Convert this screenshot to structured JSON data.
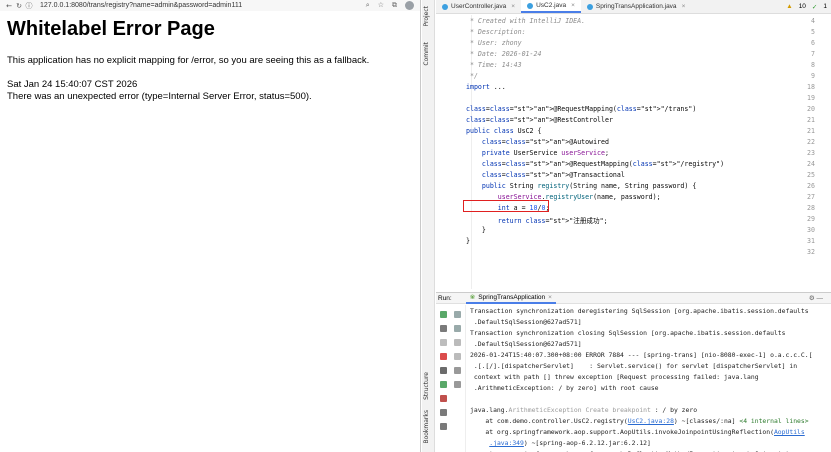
{
  "browser": {
    "url": "127.0.0.1:8080/trans/registry?name=admin&password=admin111",
    "heading": "Whitelabel Error Page",
    "message": "This application has no explicit mapping for /error, so you are seeing this as a fallback.",
    "timestamp": "Sat Jan 24 15:40:07 CST 2026",
    "error_line": "There was an unexpected error (type=Internal Server Error, status=500)."
  },
  "ide": {
    "side_labels": {
      "project": "Project",
      "commit": "Commit",
      "structure": "Structure",
      "bookmarks": "Bookmarks"
    },
    "tabs": [
      "UserController.java",
      "UsC2.java",
      "SpringTransApplication.java"
    ],
    "warn_count": "10",
    "check_count": "1",
    "code_lines": [
      {
        "n": "4",
        "t": " * Created with IntelliJ IDEA."
      },
      {
        "n": "5",
        "t": " * Description:"
      },
      {
        "n": "6",
        "t": " * User: zhony"
      },
      {
        "n": "7",
        "t": " * Date: 2026-01-24"
      },
      {
        "n": "8",
        "t": " * Time: 14:43"
      },
      {
        "n": "9",
        "t": " */"
      },
      {
        "n": "18",
        "t": "import ..."
      },
      {
        "n": "19",
        "t": ""
      },
      {
        "n": "20",
        "t": "@RequestMapping(\"/trans\")"
      },
      {
        "n": "21",
        "t": "@RestController"
      },
      {
        "n": "21",
        "t": "public class UsC2 {"
      },
      {
        "n": "22",
        "t": "    @Autowired"
      },
      {
        "n": "23",
        "t": "    private UserService userService;"
      },
      {
        "n": "24",
        "t": "    @RequestMapping(\"/registry\")"
      },
      {
        "n": "25",
        "t": "    @Transactional"
      },
      {
        "n": "26",
        "t": "    public String registry(String name, String password) {"
      },
      {
        "n": "27",
        "t": "        userService.registryUser(name, password);"
      },
      {
        "n": "28",
        "t": "        int a = 10/0;"
      },
      {
        "n": "29",
        "t": "        return \"注册成功\";"
      },
      {
        "n": "30",
        "t": "    }"
      },
      {
        "n": "31",
        "t": "}"
      },
      {
        "n": "32",
        "t": ""
      }
    ],
    "run_label": "Run:",
    "run_tab": "SpringTransApplication",
    "console_lines": [
      "Transaction synchronization deregistering SqlSession [org.apache.ibatis.session.defaults",
      " .DefaultSqlSession@627ad571]",
      "Transaction synchronization closing SqlSession [org.apache.ibatis.session.defaults",
      " .DefaultSqlSession@627ad571]",
      "2026-01-24T15:40:07.300+08:00 ERROR 7884 --- [spring-trans] [nio-8080-exec-1] o.a.c.c.C.[",
      " .[.[/].[dispatcherServlet]    : Servlet.service() for servlet [dispatcherServlet] in",
      " context with path [] threw exception [Request processing failed: java.lang",
      " .ArithmeticException: / by zero] with root cause",
      "",
      "java.lang.ArithmeticException Create breakpoint : / by zero",
      "    at com.demo.controller.UsC2.registry(UsC2.java:28) ~[classes/:na] <4 internal lines>",
      "    at org.springframework.aop.support.AopUtils.invokeJoinpointUsingReflection(AopUtils",
      "     .java:349) ~[spring-aop-6.2.12.jar:6.2.12]",
      "    at org.springframework.aop.framework.ReflectiveMethodInvocation.invokeJoinpoint"
    ]
  }
}
